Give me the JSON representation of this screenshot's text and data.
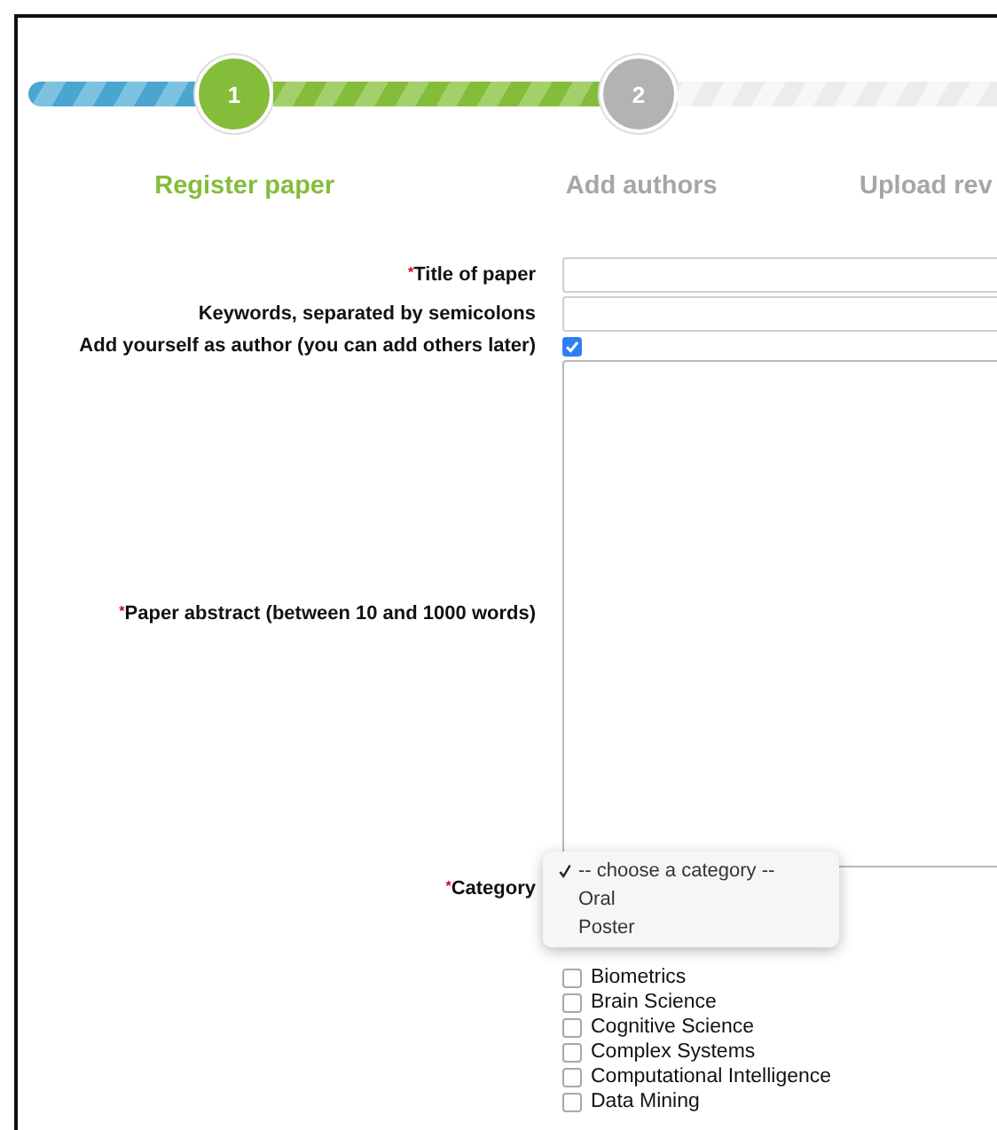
{
  "steps": [
    {
      "number": "1",
      "label": "Register paper",
      "current": true
    },
    {
      "number": "2",
      "label": "Add authors",
      "current": false
    },
    {
      "label": "Upload rev",
      "current": false
    }
  ],
  "form": {
    "title_field": {
      "label": "Title of paper",
      "required_mark": "*"
    },
    "keywords_field": {
      "label": "Keywords, separated by semicolons"
    },
    "add_self": {
      "label": "Add yourself as author (you can add others later)",
      "checked": true
    },
    "abstract_field": {
      "label": "Paper abstract (between 10 and 1000 words)",
      "required_mark": "*"
    },
    "category": {
      "label": "Category",
      "required_mark": "*",
      "options": [
        {
          "label": "-- choose a category --",
          "selected": true
        },
        {
          "label": "Oral",
          "selected": false
        },
        {
          "label": "Poster",
          "selected": false
        }
      ]
    },
    "topics": [
      {
        "label": "Biometrics",
        "checked": false
      },
      {
        "label": "Brain Science",
        "checked": false
      },
      {
        "label": "Cognitive Science",
        "checked": false
      },
      {
        "label": "Complex Systems",
        "checked": false
      },
      {
        "label": "Computational Intelligence",
        "checked": false
      },
      {
        "label": "Data Mining",
        "checked": false
      }
    ]
  }
}
